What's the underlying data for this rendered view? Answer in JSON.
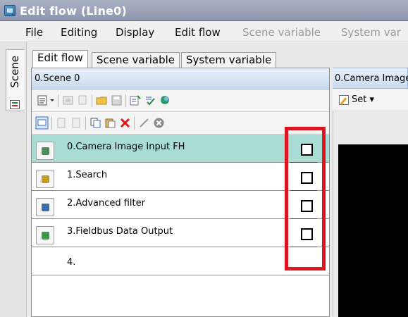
{
  "window": {
    "title": "Edit flow (Line0)"
  },
  "menu": {
    "items": [
      {
        "label": "File",
        "enabled": true
      },
      {
        "label": "Editing",
        "enabled": true
      },
      {
        "label": "Display",
        "enabled": true
      },
      {
        "label": "Edit flow",
        "enabled": true
      },
      {
        "label": "Scene variable",
        "enabled": false
      },
      {
        "label": "System var",
        "enabled": false
      }
    ]
  },
  "side_tab": {
    "label": "Scene"
  },
  "tabs": [
    {
      "label": "Edit flow",
      "active": true
    },
    {
      "label": "Scene variable",
      "active": false
    },
    {
      "label": "System variable",
      "active": false
    }
  ],
  "flow_panel": {
    "header": "0.Scene 0",
    "units": [
      {
        "label": "0.Camera Image Input FH",
        "icon": "camera-icon",
        "color": "#4b8f5a",
        "checked": false,
        "selected": true
      },
      {
        "label": "1.Search",
        "icon": "search-unit-icon",
        "color": "#c69a1e",
        "checked": false,
        "selected": false
      },
      {
        "label": "2.Advanced filter",
        "icon": "filter-icon",
        "color": "#3b6fb0",
        "checked": false,
        "selected": false
      },
      {
        "label": "3.Fieldbus Data Output",
        "icon": "fieldbus-icon",
        "color": "#3c9a4a",
        "checked": false,
        "selected": false
      },
      {
        "label": "4.",
        "icon": "",
        "color": "",
        "checked": null,
        "selected": false
      }
    ]
  },
  "right_panel": {
    "header": "0.Camera Image",
    "set_label": "Set ▾"
  },
  "colors": {
    "selected_row": "#a8dcd4",
    "highlight": "#e0141e",
    "titlebar": "#9aa1b8"
  }
}
